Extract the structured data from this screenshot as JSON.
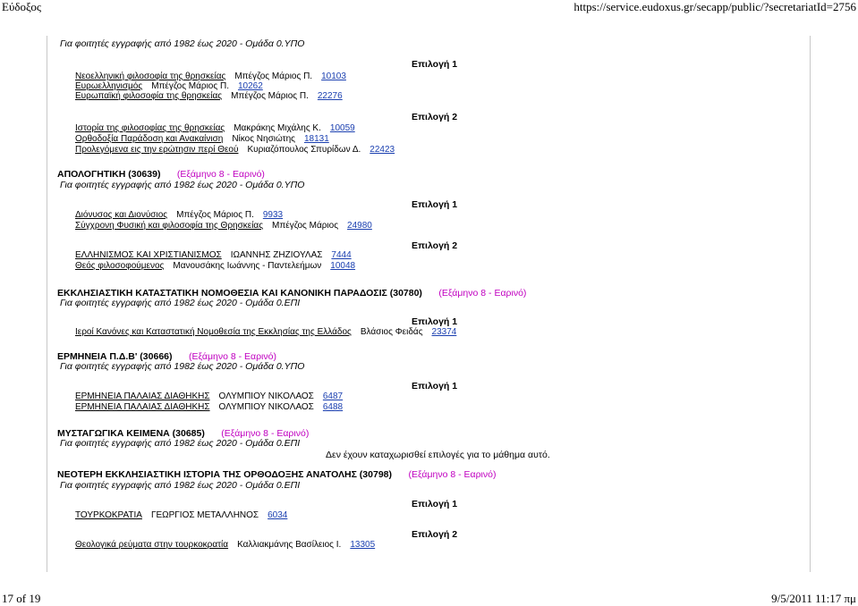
{
  "header": {
    "left": "Εύδοξος",
    "right": "https://service.eudoxus.gr/secapp/public/?secretariatId=2756"
  },
  "footer": {
    "left": "17 of 19",
    "right": "9/5/2011 11:17 πμ"
  },
  "top_note": "Για φοιτητές εγγραφής από 1982 έως 2020 - Ομάδα 0.ΥΠΟ",
  "groups": {
    "g1": {
      "choice": "Επιλογή 1",
      "books": [
        {
          "title": "Νεοελληνική φιλοσοφία της θρησκείας",
          "author": "Μπέγζος Μάριος Π.",
          "code": "10103"
        },
        {
          "title": "Ευρωελληνισμός",
          "author": "Μπέγζος Μάριος Π.",
          "code": "10262"
        },
        {
          "title": "Ευρωπαϊκή φιλοσοφία της θρησκείας",
          "author": "Μπέγζος Μάριος Π.",
          "code": "22276"
        }
      ]
    },
    "g2": {
      "choice": "Επιλογή 2",
      "books": [
        {
          "title": "Ιστορία της φιλοσοφίας της θρησκείας",
          "author": "Μακράκης Μιχάλης Κ.",
          "code": "10059"
        },
        {
          "title": "Ορθοδοξία Παράδοση και Ανακαίνιση",
          "author": "Νίκος Νησιώτης",
          "code": "18131"
        },
        {
          "title": "Προλεγόμενα εις την ερώτησιν περί Θεού",
          "author": "Κυριαζόπουλος Σπυρίδων Δ.",
          "code": "22423"
        }
      ]
    }
  },
  "courses": [
    {
      "name": "ΑΠΟΛΟΓΗΤΙΚΗ (30639)",
      "semester": "(Εξάμηνο 8 - Εαρινό)",
      "note": "Για φοιτητές εγγραφής από 1982 έως 2020 - Ομάδα 0.ΥΠΟ",
      "groups": [
        {
          "choice": "Επιλογή 1",
          "books": [
            {
              "title": "Διόνυσος και Διονύσιος",
              "author": "Μπέγζος Μάριος Π.",
              "code": "9933"
            },
            {
              "title": "Σύγχρονη Φυσική και φιλοσοφία της Θρησκείας",
              "author": "Μπέγζος Μάριος",
              "code": "24980"
            }
          ]
        },
        {
          "choice": "Επιλογή 2",
          "books": [
            {
              "title": "ΕΛΛΗΝΙΣΜΟΣ ΚΑΙ ΧΡΙΣΤΙΑΝΙΣΜΟΣ",
              "author": "ΙΩΑΝΝΗΣ ΖΗΖΙΟΥΛΑΣ",
              "code": "7444"
            },
            {
              "title": "Θεός φιλοσοφούμενος",
              "author": "Μανουσάκης Ιωάννης - Παντελεήμων",
              "code": "10048"
            }
          ]
        }
      ]
    },
    {
      "name": "ΕΚΚΛΗΣΙΑΣΤΙΚΗ ΚΑΤΑΣΤΑΤΙΚΗ ΝΟΜΟΘΕΣΙΑ ΚΑΙ ΚΑΝΟΝΙΚΗ ΠΑΡΑΔΟΣΙΣ (30780)",
      "semester": "(Εξάμηνο 8 - Εαρινό)",
      "note": "Για φοιτητές εγγραφής από 1982 έως 2020 - Ομάδα 0.ΕΠΙ",
      "groups": [
        {
          "choice": "Επιλογή 1",
          "books": [
            {
              "title": "Ιεροί Κανόνες και Καταστατική Νομοθεσία της Εκκλησίας της Ελλάδος",
              "author": "Βλάσιος Φειδάς",
              "code": "23374"
            }
          ]
        }
      ]
    },
    {
      "name": "ΕΡΜΗΝΕΙΑ Π.Δ.Β' (30666)",
      "semester": "(Εξάμηνο 8 - Εαρινό)",
      "note": "Για φοιτητές εγγραφής από 1982 έως 2020 - Ομάδα 0.ΥΠΟ",
      "groups": [
        {
          "choice": "Επιλογή 1",
          "books": [
            {
              "title": "ΕΡΜΗΝΕΙΑ ΠΑΛΑΙΑΣ ΔΙΑΘΗΚΗΣ",
              "author": "ΟΛΥΜΠΙΟΥ ΝΙΚΟΛΑΟΣ",
              "code": "6487"
            },
            {
              "title": "ΕΡΜΗΝΕΙΑ ΠΑΛΑΙΑΣ ΔΙΑΘΗΚΗΣ",
              "author": "ΟΛΥΜΠΙΟΥ ΝΙΚΟΛΑΟΣ",
              "code": "6488"
            }
          ]
        }
      ]
    },
    {
      "name": "ΜΥΣΤΑΓΩΓΙΚΑ ΚΕΙΜΕΝΑ (30685)",
      "semester": "(Εξάμηνο 8 - Εαρινό)",
      "note": "Για φοιτητές εγγραφής από 1982 έως 2020 - Ομάδα 0.ΕΠΙ",
      "no_choices": "Δεν έχουν καταχωρισθεί επιλογές για το μάθημα αυτό."
    },
    {
      "name": "ΝΕΟΤΕΡΗ ΕΚΚΛΗΣΙΑΣΤΙΚΗ ΙΣΤΟΡΙΑ ΤΗΣ ΟΡΘΟΔΟΞΗΣ ΑΝΑΤΟΛΗΣ (30798)",
      "semester": "(Εξάμηνο 8 - Εαρινό)",
      "note": "Για φοιτητές εγγραφής από 1982 έως 2020 - Ομάδα 0.ΕΠΙ",
      "groups": [
        {
          "choice": "Επιλογή 1",
          "books": [
            {
              "title": "ΤΟΥΡΚΟΚΡΑΤΙΑ",
              "author": "ΓΕΩΡΓΙΟΣ ΜΕΤΑΛΛΗΝΟΣ",
              "code": "6034"
            }
          ]
        },
        {
          "choice": "Επιλογή 2",
          "books": [
            {
              "title": "Θεολογικά ρεύματα στην τουρκοκρατία",
              "author": "Καλλιακμάνης Βασίλειος Ι.",
              "code": "13305"
            }
          ]
        }
      ]
    }
  ]
}
